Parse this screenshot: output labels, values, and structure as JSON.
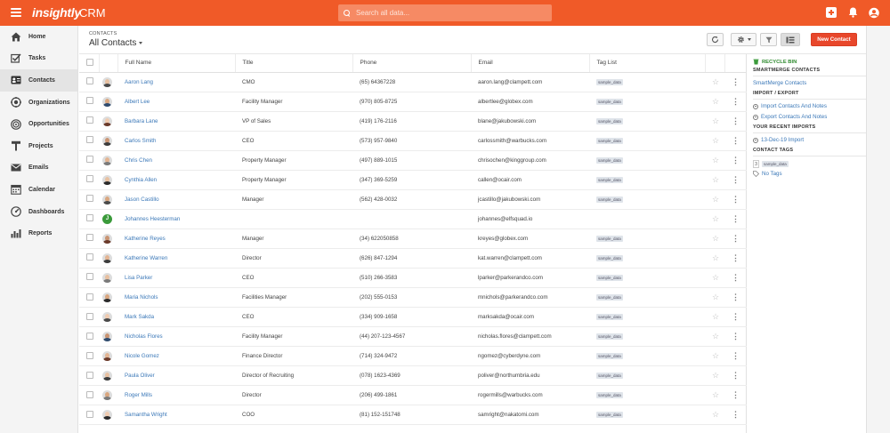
{
  "app": {
    "brand": "insightly",
    "module": "CRM"
  },
  "search": {
    "placeholder": "Search all data..."
  },
  "sidebar": {
    "items": [
      {
        "label": "Home",
        "icon": "home-icon"
      },
      {
        "label": "Tasks",
        "icon": "tasks-icon"
      },
      {
        "label": "Contacts",
        "icon": "contacts-icon",
        "active": true
      },
      {
        "label": "Organizations",
        "icon": "organizations-icon"
      },
      {
        "label": "Opportunities",
        "icon": "opportunities-icon"
      },
      {
        "label": "Projects",
        "icon": "projects-icon"
      },
      {
        "label": "Emails",
        "icon": "emails-icon"
      },
      {
        "label": "Calendar",
        "icon": "calendar-icon"
      },
      {
        "label": "Dashboards",
        "icon": "dashboards-icon"
      },
      {
        "label": "Reports",
        "icon": "reports-icon"
      }
    ]
  },
  "header": {
    "breadcrumb": "CONTACTS",
    "view_title": "All Contacts",
    "new_button": "New Contact"
  },
  "table": {
    "columns": [
      "Full Name",
      "Title",
      "Phone",
      "Email",
      "Tag List"
    ],
    "rows": [
      {
        "name": "Aaron Lang",
        "title": "CMO",
        "phone": "(65) 64367228",
        "email": "aaron.lang@clampett.com",
        "tag": "sample_data"
      },
      {
        "name": "Albert Lee",
        "title": "Facility Manager",
        "phone": "(970) 805-8725",
        "email": "albertlee@globex.com",
        "tag": "sample_data"
      },
      {
        "name": "Barbara Lane",
        "title": "VP of Sales",
        "phone": "(419) 176-2116",
        "email": "blane@jakubowski.com",
        "tag": "sample_data"
      },
      {
        "name": "Carlos Smith",
        "title": "CEO",
        "phone": "(573) 957-9840",
        "email": "carlossmith@warbucks.com",
        "tag": "sample_data"
      },
      {
        "name": "Chris Chen",
        "title": "Property Manager",
        "phone": "(497) 889-1015",
        "email": "chrisochen@kinggroup.com",
        "tag": "sample_data"
      },
      {
        "name": "Cynthia Allen",
        "title": "Property Manager",
        "phone": "(347) 369-5259",
        "email": "callen@ocair.com",
        "tag": "sample_data"
      },
      {
        "name": "Jason Castillo",
        "title": "Manager",
        "phone": "(562) 428-0032",
        "email": "jcastillo@jakubowski.com",
        "tag": "sample_data"
      },
      {
        "name": "Johannes Heesterman",
        "title": "",
        "phone": "",
        "email": "johannes@elfsquad.io",
        "tag": "",
        "initial": "J"
      },
      {
        "name": "Katherine Reyes",
        "title": "Manager",
        "phone": "(34) 622050858",
        "email": "kreyes@globex.com",
        "tag": "sample_data"
      },
      {
        "name": "Katherine Warren",
        "title": "Director",
        "phone": "(626) 847-1294",
        "email": "kat.warren@clampett.com",
        "tag": "sample_data"
      },
      {
        "name": "Lisa Parker",
        "title": "CEO",
        "phone": "(510) 266-3583",
        "email": "lparker@parkerandco.com",
        "tag": "sample_data"
      },
      {
        "name": "Maria Nichols",
        "title": "Facilities Manager",
        "phone": "(202) 555-0153",
        "email": "mnichols@parkerandco.com",
        "tag": "sample_data"
      },
      {
        "name": "Mark Sakda",
        "title": "CEO",
        "phone": "(334) 909-1658",
        "email": "marksakda@ocair.com",
        "tag": "sample_data"
      },
      {
        "name": "Nicholas Flores",
        "title": "Facility Manager",
        "phone": "(44) 207-123-4567",
        "email": "nicholas.flores@clampett.com",
        "tag": "sample_data"
      },
      {
        "name": "Nicole Gomez",
        "title": "Finance Director",
        "phone": "(714) 324-9472",
        "email": "ngomez@cyberdyne.com",
        "tag": "sample_data"
      },
      {
        "name": "Paula Oliver",
        "title": "Director of Recruiting",
        "phone": "(078) 1623-4369",
        "email": "poliver@northumbria.edu",
        "tag": "sample_data"
      },
      {
        "name": "Roger Mills",
        "title": "Director",
        "phone": "(206) 499-1861",
        "email": "rogermills@warbucks.com",
        "tag": "sample_data"
      },
      {
        "name": "Samantha Wright",
        "title": "COO",
        "phone": "(81) 152-151748",
        "email": "samright@nakatomi.com",
        "tag": "sample_data"
      }
    ]
  },
  "right_panel": {
    "recycle_bin": "RECYCLE BIN",
    "smartmerge_heading": "SMARTMERGE CONTACTS",
    "smartmerge_link": "SmartMerge Contacts",
    "import_export_heading": "IMPORT / EXPORT",
    "import_link": "Import Contacts And Notes",
    "export_link": "Export Contacts And Notes",
    "recent_imports_heading": "YOUR RECENT IMPORTS",
    "recent_import": "13-Dec-19 Import",
    "contact_tags_heading": "CONTACT TAGS",
    "tag_count": "3",
    "tag_name": "sample_data",
    "no_tags": "No Tags"
  },
  "colors": {
    "brand": "#f05a28",
    "new_button": "#e8472b",
    "link": "#3b78b8"
  }
}
